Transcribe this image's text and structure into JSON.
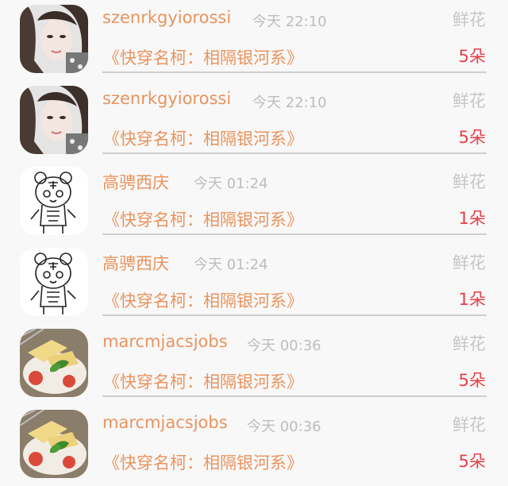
{
  "rows": [
    {
      "avatar": "woman-photo",
      "name": "szenrkgyiorossi",
      "time": "今天 22:10",
      "gift": "鲜花",
      "book": "《快穿名柯：相隔银河系》",
      "count": "5朵"
    },
    {
      "avatar": "woman-photo",
      "name": "szenrkgyiorossi",
      "time": "今天 22:10",
      "gift": "鲜花",
      "book": "《快穿名柯：相隔银河系》",
      "count": "5朵"
    },
    {
      "avatar": "cartoon-tiger",
      "name": "高骋西庆",
      "time": "今天 01:24",
      "gift": "鲜花",
      "book": "《快穿名柯：相隔银河系》",
      "count": "1朵"
    },
    {
      "avatar": "cartoon-tiger",
      "name": "高骋西庆",
      "time": "今天 01:24",
      "gift": "鲜花",
      "book": "《快穿名柯：相隔银河系》",
      "count": "1朵"
    },
    {
      "avatar": "food-photo",
      "name": "marcmjacsjobs",
      "time": "今天 00:36",
      "gift": "鲜花",
      "book": "《快穿名柯：相隔银河系》",
      "count": "5朵"
    },
    {
      "avatar": "food-photo",
      "name": "marcmjacsjobs",
      "time": "今天 00:36",
      "gift": "鲜花",
      "book": "《快穿名柯：相隔银河系》",
      "count": "5朵"
    }
  ]
}
